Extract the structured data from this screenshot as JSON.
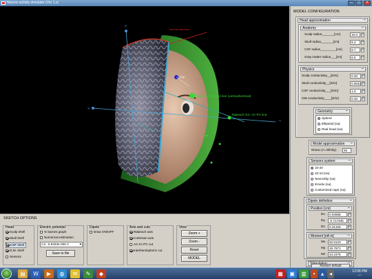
{
  "window": {
    "title": "Neuron activity simulator (Ver 1.x)"
  },
  "scene": {
    "normal_direction_label": "Normal direction",
    "vca_line_label": "Talairach OX: VCA line (vertical/vertical)",
    "acpc_line_label": "Talairach OX: AC-PC line",
    "dipole_label": "Dip",
    "axes": {
      "x": "X",
      "y": "Y",
      "z": "Z"
    }
  },
  "panel": {
    "title": "MODEL CONFIGURATION",
    "head_approx": {
      "header": "Head approximation",
      "anatomy": {
        "header": "Anatomy",
        "rows": [
          {
            "label": "Scalp radius_______[cm]",
            "value": "10.0"
          },
          {
            "label": "Skull radius_______[cm]",
            "value": "9.4"
          },
          {
            "label": "CSF radius_________[cm]",
            "value": "8.7"
          },
          {
            "label": "Gray matter radius___[cm]",
            "value": "8.5"
          }
        ]
      },
      "physics": {
        "header": "Physics",
        "rows": [
          {
            "label": "Scalp conductivity__[S/m]",
            "value": "0.33"
          },
          {
            "label": "Skull conductivity__[S/m]",
            "value": "0.0042"
          },
          {
            "label": "CSF conductivity___[S/m]",
            "value": "1.0"
          },
          {
            "label": "GM conductivity____[S/m]",
            "value": "0.33"
          }
        ]
      },
      "geometry": {
        "header": "Geometry",
        "options": [
          "Sphere",
          "Ellipsoid (na)",
          "Real head (na)"
        ],
        "selected": 0
      }
    },
    "model_approx": {
      "header": "Model approximation",
      "label": "Nmax=(<=infinity)",
      "value": "45"
    },
    "sensors": {
      "header": "Sensors system",
      "options": [
        "10-20",
        "10-10 (na)",
        "NeuroSky (na)",
        "Emotiv (na)",
        "Customized caps (na)"
      ],
      "selected": 0
    },
    "dipole_def": {
      "header": "Dipole definition",
      "position": {
        "header": "Position [cm]",
        "rows": [
          {
            "label": "Dx",
            "value": "0.94568"
          },
          {
            "label": "Dy",
            "value": "-0.717405"
          },
          {
            "label": "Dz",
            "value": "0.31326"
          }
        ]
      },
      "moment": {
        "header": "Moment [nA m]",
        "rows": [
          {
            "label": "Mx",
            "value": "62.6123"
          },
          {
            "label": "My",
            "value": "26.7871"
          },
          {
            "label": "Mz",
            "value": "34.2475"
          }
        ]
      }
    },
    "stimulation": {
      "header": "Stimulation",
      "button": "Restore default"
    }
  },
  "sketch": {
    "title": "SKETCH OPTIONS",
    "head": {
      "legend": "Head",
      "items": [
        {
          "label": "Scalp shell",
          "checked": true
        },
        {
          "label": "Skull shell",
          "checked": true
        },
        {
          "label": "CSF shell",
          "checked": true
        },
        {
          "label": "G.M. shell",
          "checked": true
        },
        {
          "label": "Sensors",
          "checked": false
        }
      ]
    },
    "potential": {
      "legend": "Electric potential",
      "items": [
        {
          "label": "% barnes graph",
          "checked": false
        },
        {
          "label": "Numerical estimation",
          "checked": false
        }
      ],
      "value": "C3: -6.9333e-005 V",
      "button": "Save to file"
    },
    "dipole": {
      "legend": "Dipole",
      "item": "Draw ON/OFF",
      "checked": false
    },
    "axes": {
      "legend": "Axis and cuts",
      "items": [
        {
          "label": "Talairach axis",
          "checked": true
        },
        {
          "label": "Cartesian axis",
          "checked": true
        },
        {
          "label": "AC-Cr-PC cut",
          "checked": false
        },
        {
          "label": "Interhemispheric cut",
          "checked": true
        }
      ]
    },
    "view": {
      "legend": "View",
      "buttons": [
        "Zoom +",
        "Zoom -",
        "Reset",
        "MODEL"
      ]
    }
  },
  "taskbar": {
    "icons": [
      "folder-icon",
      "word-icon",
      "media-icon",
      "globe-icon",
      "mail-icon",
      "paint-icon",
      "matlab-icon",
      "chart-icon",
      "photo-icon",
      "calc-icon"
    ],
    "time": "12:06 PM",
    "date": "—"
  }
}
